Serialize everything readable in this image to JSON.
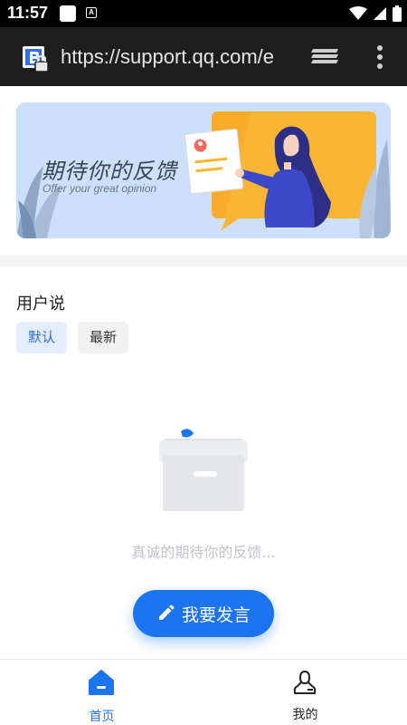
{
  "status_bar": {
    "time": "11:57",
    "notification_letter": "A",
    "icons": [
      "square-notification-icon",
      "a-notification-icon",
      "wifi-icon",
      "signal-icon",
      "battery-icon"
    ]
  },
  "browser": {
    "url": "https://support.qq.com/e",
    "icons": [
      "site-lock-icon",
      "tabs-icon",
      "more-vert-icon"
    ]
  },
  "banner": {
    "title": "期待你的反馈",
    "subtitle": "Offer your great opinion"
  },
  "section": {
    "title": "用户说",
    "filters": [
      {
        "label": "默认",
        "active": true
      },
      {
        "label": "最新",
        "active": false
      }
    ]
  },
  "empty_state": {
    "icon": "empty-box-icon",
    "text": "真诚的期待你的反馈..."
  },
  "fab": {
    "label": "我要发言",
    "icon": "pencil-icon"
  },
  "tabbar": {
    "tabs": [
      {
        "label": "首页",
        "icon": "home-icon",
        "active": true
      },
      {
        "label": "我的",
        "icon": "person-icon",
        "active": false
      }
    ]
  },
  "colors": {
    "accent": "#1b74f0",
    "chip_active_bg": "#e4edfd",
    "chip_active_text": "#2b69e8",
    "browser_bar": "#1e1e1e"
  }
}
